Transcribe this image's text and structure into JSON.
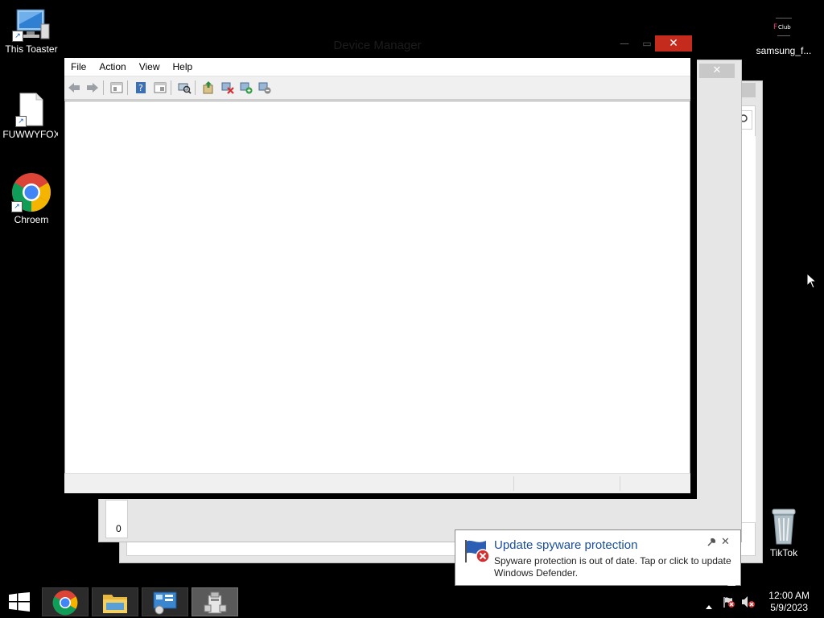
{
  "desktop": {
    "icons": [
      {
        "label": "This Toaster"
      },
      {
        "label": "FUWWYFOX"
      },
      {
        "label": "Chroem"
      },
      {
        "label": "samsung_f..."
      },
      {
        "label": "TikTok"
      }
    ]
  },
  "background_window": {
    "partial_value": "0"
  },
  "device_manager": {
    "title": "Device Manager",
    "menu": [
      "File",
      "Action",
      "View",
      "Help"
    ],
    "toolbar_icons": [
      "back-icon",
      "forward-icon",
      "console-tree-icon",
      "help-icon",
      "properties-icon",
      "scan-hardware-icon",
      "update-driver-icon",
      "uninstall-icon",
      "enable-device-icon",
      "disable-device-icon"
    ]
  },
  "notification": {
    "title": "Update spyware protection",
    "body": "Spyware protection is out of date. Tap or click to update Windows Defender."
  },
  "taskbar": {
    "buttons": [
      "start-icon",
      "chrome-icon",
      "file-explorer-icon",
      "control-panel-icon",
      "device-manager-icon"
    ],
    "tray_icons": [
      "show-hidden-icons-icon",
      "action-center-icon",
      "volume-muted-icon"
    ],
    "clock": {
      "time": "12:00 AM",
      "date": "5/9/2023"
    }
  },
  "colors": {
    "close_button": "#c42b1c",
    "toast_title": "#1a4e9a",
    "desktop": "#000000"
  }
}
